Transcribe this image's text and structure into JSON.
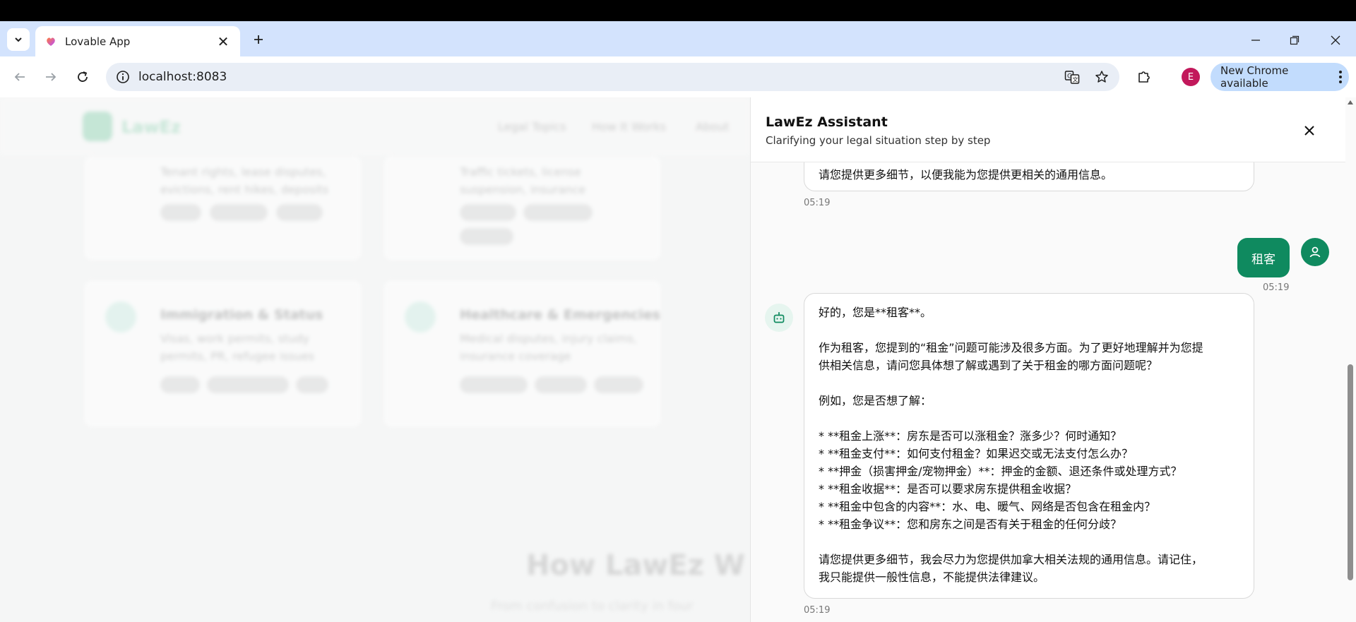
{
  "browser": {
    "tab_title": "Lovable App",
    "url": "localhost:8083",
    "profile_initial": "E",
    "update_label": "New Chrome available",
    "icons": [
      "tab-search-icon",
      "close-icon",
      "plus-icon",
      "minimize-icon",
      "restore-icon",
      "back-icon",
      "forward-icon",
      "reload-icon",
      "info-icon",
      "translate-icon",
      "star-icon",
      "extensions-icon",
      "more-icon"
    ]
  },
  "background_page": {
    "brand": "LawEz",
    "nav_links": [
      "Legal Topics",
      "How It Works",
      "About"
    ],
    "cards": [
      {
        "title": "",
        "text": "Tenant rights, lease disputes, evictions, rent hikes, deposits"
      },
      {
        "title": "",
        "text": "Traffic tickets, license suspension, insurance"
      },
      {
        "title": "Immigration & Status",
        "text": "Visas, work permits, study permits, PR, refugee issues"
      },
      {
        "title": "Healthcare & Emergencies",
        "text": "Medical disputes, injury claims, insurance coverage"
      }
    ],
    "heading": "How LawEz W",
    "subheading": "From confusion to clarity in four"
  },
  "assistant": {
    "title": "LawEz Assistant",
    "subtitle": "Clarifying your legal situation step by step",
    "messages": {
      "prev_bot_tail": "请您提供更多细节，以便我能为您提供更相关的通用信息。",
      "prev_bot_time": "05:19",
      "user_text": "租客",
      "user_time": "05:19",
      "bot_lines": [
        "好的，您是**租客**。",
        "",
        "作为租客，您提到的“租金”问题可能涉及很多方面。为了更好地理解并为您提",
        "供相关信息，请问您具体想了解或遇到了关于租金的哪方面问题呢？",
        "",
        "例如，您是否想了解：",
        "",
        "*   **租金上涨**：房东是否可以涨租金？涨多少？何时通知？",
        "*   **租金支付**：如何支付租金？如果迟交或无法支付怎么办？",
        "*   **押金（损害押金/宠物押金）**：押金的金额、退还条件或处理方式？",
        "*   **租金收据**：是否可以要求房东提供租金收据？",
        "*   **租金中包含的内容**：水、电、暖气、网络是否包含在租金内？",
        "*   **租金争议**：您和房东之间是否有关于租金的任何分歧？",
        "",
        "请您提供更多细节，我会尽力为您提供加拿大相关法规的通用信息。请记住，",
        "我只能提供一般性信息，不能提供法律建议。"
      ],
      "bot_time": "05:19"
    }
  },
  "colors": {
    "brand_green": "#0f8a5f",
    "tabstrip": "#d3e3fd",
    "update_pill": "#c2dcfd"
  }
}
